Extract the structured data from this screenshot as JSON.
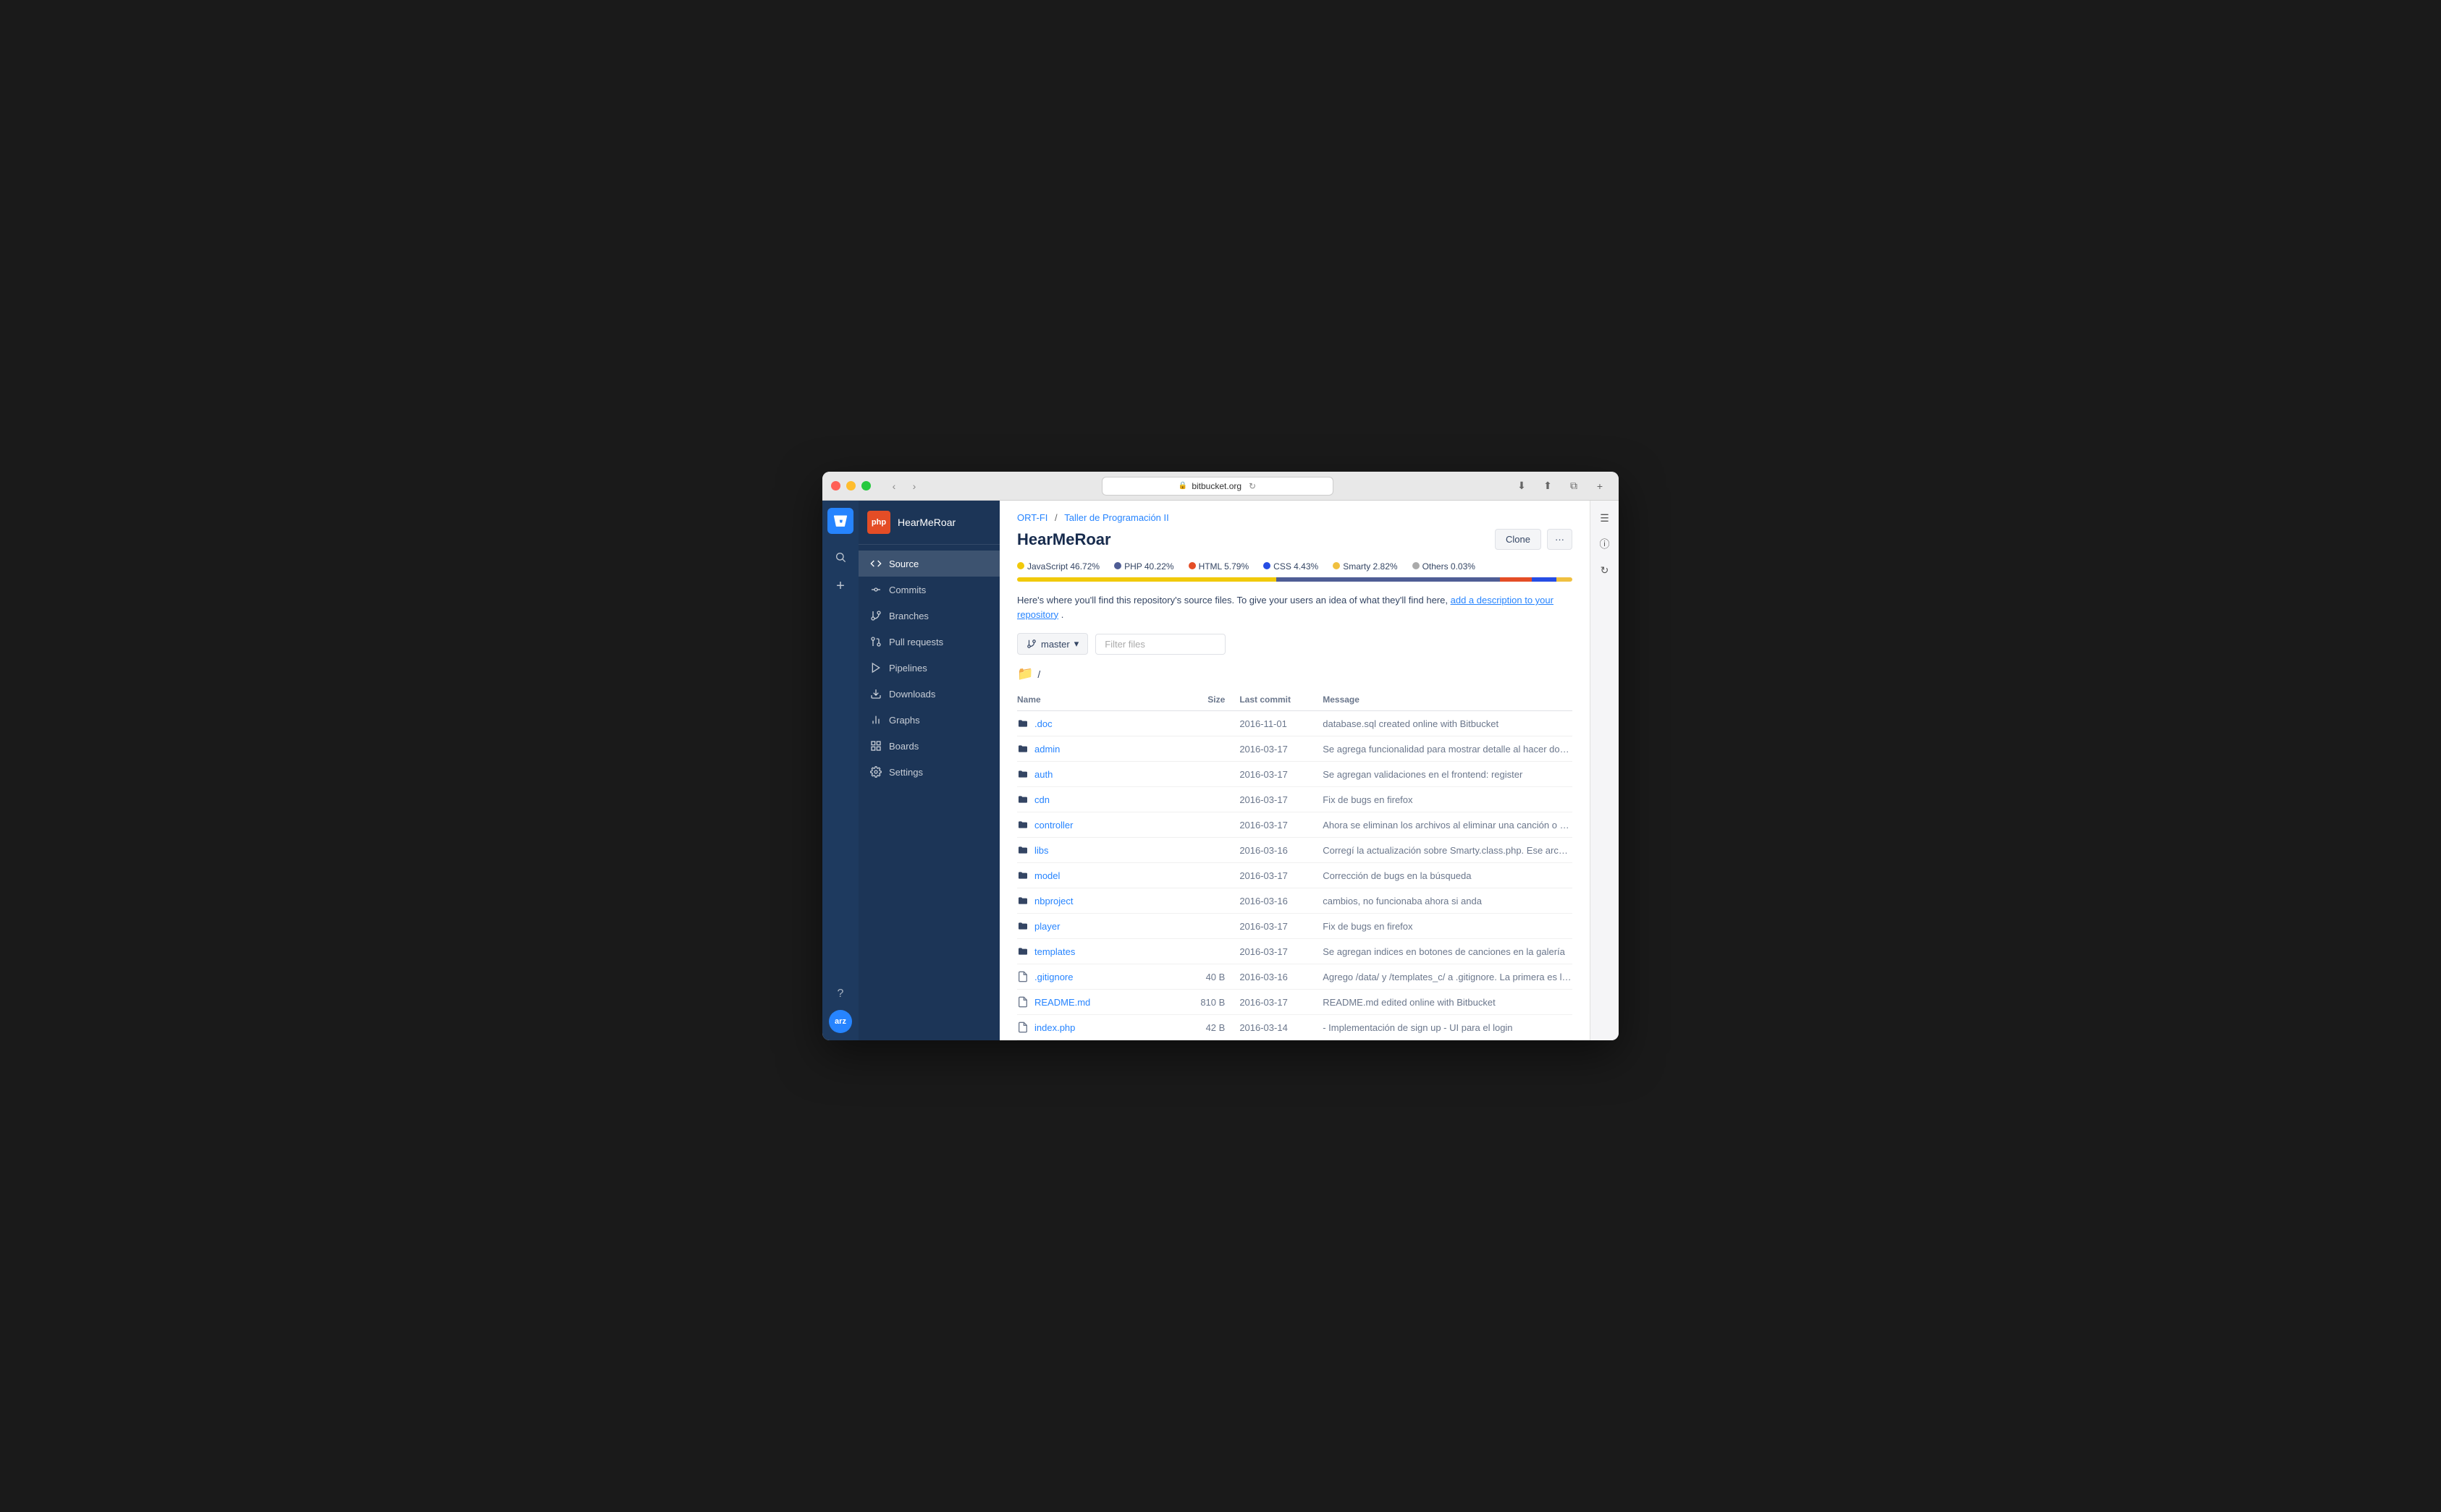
{
  "window": {
    "title": "bitbucket.org",
    "url": "bitbucket.org"
  },
  "breadcrumb": {
    "org": "ORT-FI",
    "separator": "/",
    "project": "Taller de Programación II"
  },
  "repo": {
    "name": "HearMeRoar",
    "icon_text": "php",
    "clone_label": "Clone",
    "more_label": "···"
  },
  "languages": [
    {
      "name": "JavaScript",
      "pct": "46.72%",
      "color": "#f1c90a",
      "width": "46.72"
    },
    {
      "name": "PHP",
      "pct": "40.22%",
      "color": "#4f5d95",
      "width": "40.22"
    },
    {
      "name": "HTML",
      "pct": "5.79%",
      "color": "#e44d26",
      "width": "5.79"
    },
    {
      "name": "CSS",
      "pct": "4.43%",
      "color": "#264de4",
      "width": "4.43"
    },
    {
      "name": "Smarty",
      "pct": "2.82%",
      "color": "#f0c040",
      "width": "2.82"
    },
    {
      "name": "Others",
      "pct": "0.03%",
      "color": "#aaaaaa",
      "width": "0.03"
    }
  ],
  "description": {
    "text": "Here's where you'll find this repository's source files. To give your users an idea of what they'll find here,",
    "link_text": "add a description to your repository",
    "link_suffix": "."
  },
  "branch": {
    "label": "master",
    "icon": "⑂"
  },
  "filter_placeholder": "Filter files",
  "path": "/",
  "table": {
    "headers": {
      "name": "Name",
      "size": "Size",
      "last_commit": "Last commit",
      "message": "Message"
    },
    "rows": [
      {
        "type": "folder",
        "name": ".doc",
        "size": "",
        "commit": "2016-11-01",
        "message": "database.sql created online with Bitbucket"
      },
      {
        "type": "folder",
        "name": "admin",
        "size": "",
        "commit": "2016-03-17",
        "message": "Se agrega funcionalidad para mostrar detalle al hacer doble clic sobre una fila en el abm"
      },
      {
        "type": "folder",
        "name": "auth",
        "size": "",
        "commit": "2016-03-17",
        "message": "Se agregan validaciones en el frontend: register"
      },
      {
        "type": "folder",
        "name": "cdn",
        "size": "",
        "commit": "2016-03-17",
        "message": "Fix de bugs en firefox"
      },
      {
        "type": "folder",
        "name": "controller",
        "size": "",
        "commit": "2016-03-17",
        "message": "Ahora se eliminan los archivos al eliminar una canción o un álbum"
      },
      {
        "type": "folder",
        "name": "libs",
        "size": "",
        "commit": "2016-03-16",
        "message": "Corregí la actualización sobre Smarty.class.php. Ese archivo no debería tocarse, pertenece ..."
      },
      {
        "type": "folder",
        "name": "model",
        "size": "",
        "commit": "2016-03-17",
        "message": "Corrección de bugs en la búsqueda"
      },
      {
        "type": "folder",
        "name": "nbproject",
        "size": "",
        "commit": "2016-03-16",
        "message": "cambios, no funcionaba ahora si anda"
      },
      {
        "type": "folder",
        "name": "player",
        "size": "",
        "commit": "2016-03-17",
        "message": "Fix de bugs en firefox"
      },
      {
        "type": "folder",
        "name": "templates",
        "size": "",
        "commit": "2016-03-17",
        "message": "Se agregan indices en botones de canciones en la galería"
      },
      {
        "type": "file",
        "name": ".gitignore",
        "size": "40 B",
        "commit": "2016-03-16",
        "message": "Agrego /data/ y /templates_c/ a .gitignore. La primera es la carpeta de datos, no pertenece a..."
      },
      {
        "type": "file",
        "name": "README.md",
        "size": "810 B",
        "commit": "2016-03-17",
        "message": "README.md edited online with Bitbucket"
      },
      {
        "type": "file",
        "name": "index.php",
        "size": "42 B",
        "commit": "2016-03-14",
        "message": "- Implementación de sign up - UI para el login"
      }
    ]
  },
  "sidebar": {
    "repo_name": "HearMeRoar",
    "items": [
      {
        "label": "Source",
        "active": true
      },
      {
        "label": "Commits",
        "active": false
      },
      {
        "label": "Branches",
        "active": false
      },
      {
        "label": "Pull requests",
        "active": false
      },
      {
        "label": "Pipelines",
        "active": false
      },
      {
        "label": "Downloads",
        "active": false
      },
      {
        "label": "Graphs",
        "active": false
      },
      {
        "label": "Boards",
        "active": false
      },
      {
        "label": "Settings",
        "active": false
      }
    ]
  },
  "user": {
    "initials": "arz"
  }
}
